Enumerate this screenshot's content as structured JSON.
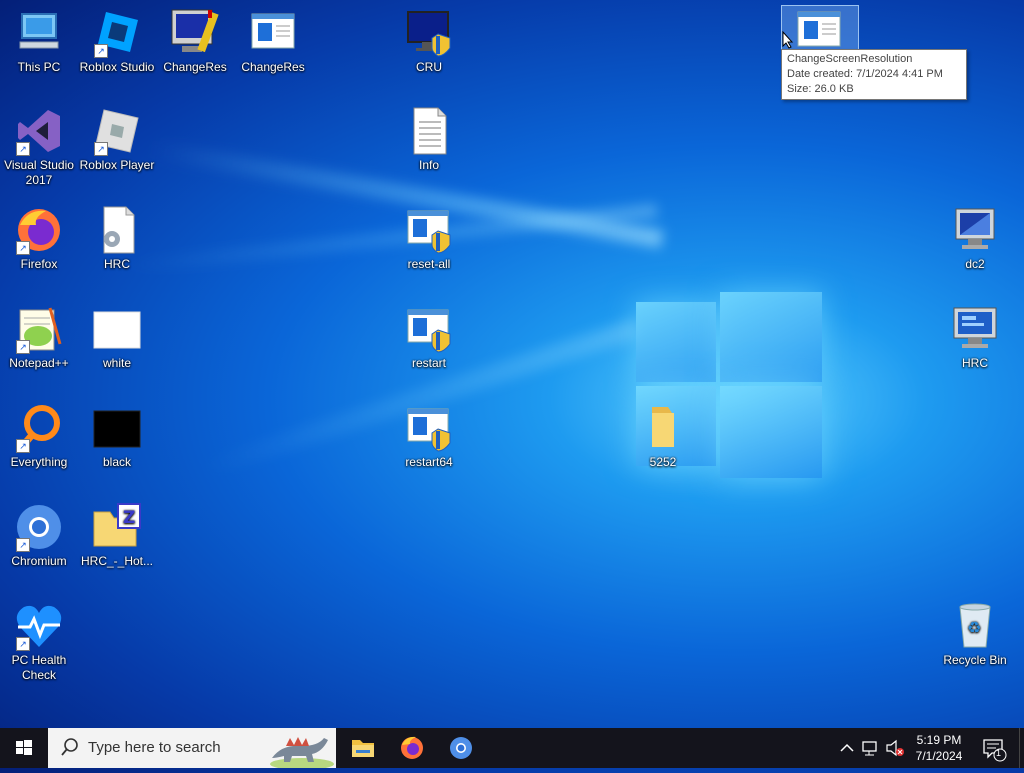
{
  "desktop": {
    "icons": [
      {
        "label": "This PC"
      },
      {
        "label": "Roblox Studio"
      },
      {
        "label": "ChangeRes"
      },
      {
        "label": "ChangeRes"
      },
      {
        "label": "CRU"
      },
      {
        "label": "Visual Studio 2017"
      },
      {
        "label": "Roblox Player"
      },
      {
        "label": "Info"
      },
      {
        "label": "Firefox"
      },
      {
        "label": "HRC"
      },
      {
        "label": "reset-all"
      },
      {
        "label": "dc2"
      },
      {
        "label": "Notepad++"
      },
      {
        "label": "white"
      },
      {
        "label": "restart"
      },
      {
        "label": "HRC"
      },
      {
        "label": "Everything"
      },
      {
        "label": "black"
      },
      {
        "label": "restart64"
      },
      {
        "label": "5252"
      },
      {
        "label": "Chromium"
      },
      {
        "label": "HRC_-_Hot..."
      },
      {
        "label": "PC Health Check"
      },
      {
        "label": "Recycle Bin"
      }
    ]
  },
  "tooltip": {
    "name": "ChangeScreenResolution",
    "date": "Date created: 7/1/2024 4:41 PM",
    "size": "Size: 26.0 KB"
  },
  "taskbar": {
    "search_placeholder": "Type here to search",
    "time": "5:19 PM",
    "date": "7/1/2024",
    "notification_count": "1"
  },
  "colors": {
    "taskbar": "#14141c",
    "accent": "#0a66d8"
  }
}
